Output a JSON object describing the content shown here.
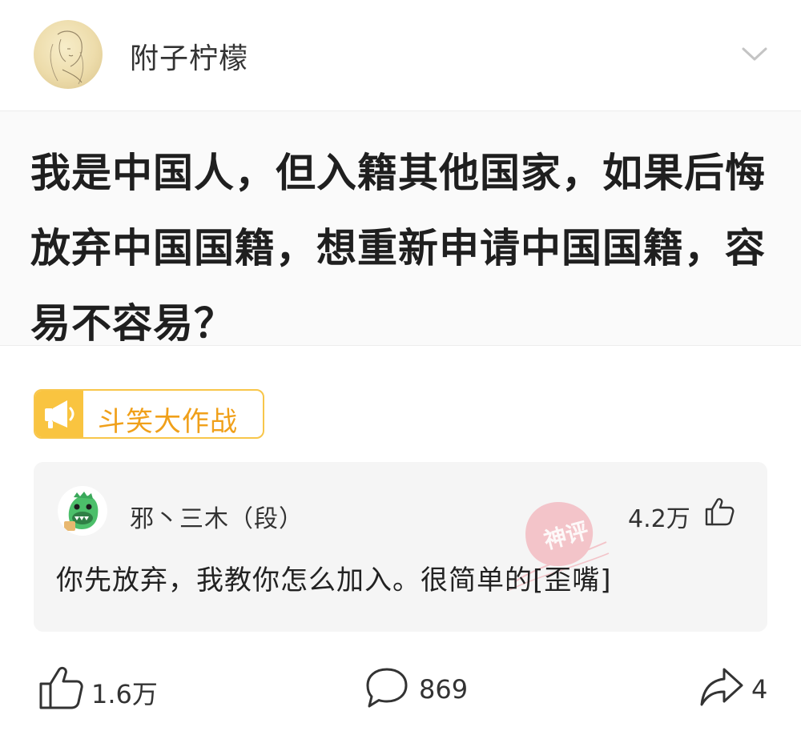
{
  "header": {
    "username": "附子柠檬",
    "avatar_icon": "sketch-portrait-avatar",
    "menu_icon": "chevron-down-icon"
  },
  "question": {
    "title": "我是中国人，但入籍其他国家，如果后悔放弃中国国籍，想重新申请中国国籍，容易不容易？"
  },
  "tag": {
    "icon": "megaphone-icon",
    "label": "斗笑大作战",
    "accent_color": "#f9c440",
    "text_color": "#f0a01a"
  },
  "top_comment": {
    "author": "邪丶三木（段）",
    "avatar_icon": "green-dinosaur-avatar",
    "likes": "4.2万",
    "text": "你先放弃，我教你怎么加入。很简单的[歪嘴]",
    "stamp_label": "神评",
    "stamp_color": "#f06b7a"
  },
  "actions": {
    "like_count": "1.6万",
    "comment_count": "869",
    "share_count": "4"
  }
}
